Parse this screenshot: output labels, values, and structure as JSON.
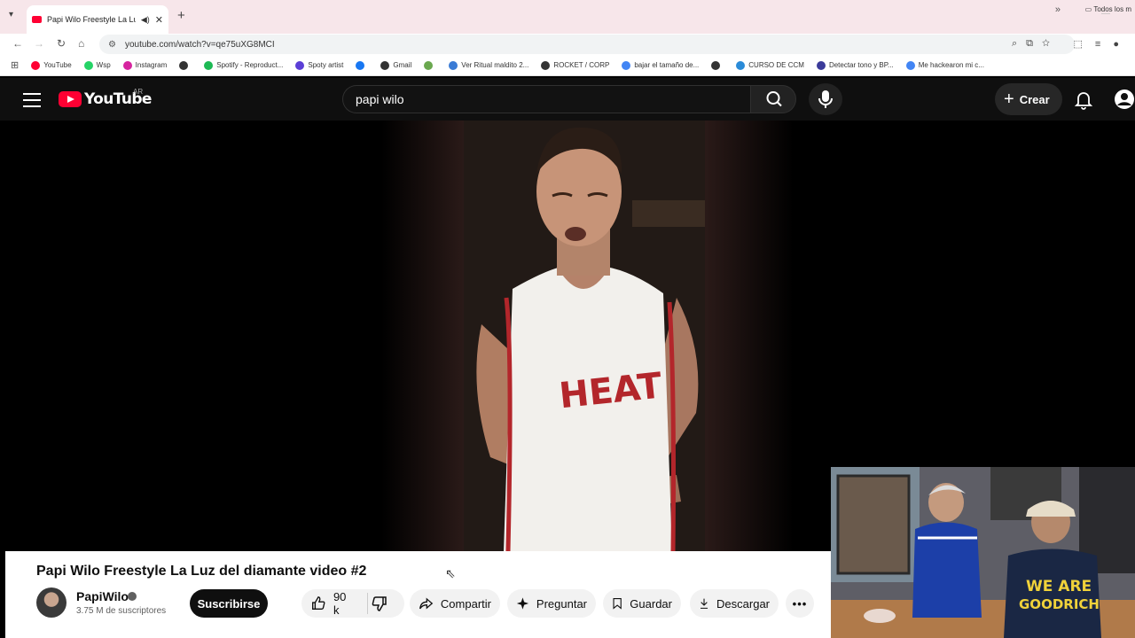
{
  "browser": {
    "tab_title": "Papi Wilo Freestyle La Luz d",
    "url": "youtube.com/watch?v=qe75uXG8MCI",
    "bookmarks": [
      {
        "label": "YouTube",
        "color": "#ff0033"
      },
      {
        "label": "Wsp",
        "color": "#25d366"
      },
      {
        "label": "Instagram",
        "color": "#d6249f"
      },
      {
        "label": "",
        "color": "#333333"
      },
      {
        "label": "Spotify - Reproduct...",
        "color": "#1db954"
      },
      {
        "label": "Spoty artist",
        "color": "#5b3fd6"
      },
      {
        "label": "",
        "color": "#1877f2"
      },
      {
        "label": "Gmail",
        "color": "#333333"
      },
      {
        "label": "",
        "color": "#6aa84f"
      },
      {
        "label": "Ver Ritual maldito 2...",
        "color": "#3a7bd5"
      },
      {
        "label": "ROCKET / CORP",
        "color": "#333333"
      },
      {
        "label": "bajar el tamaño de...",
        "color": "#4285f4"
      },
      {
        "label": "",
        "color": "#333333"
      },
      {
        "label": "CURSO DE CCM",
        "color": "#2a8bd8"
      },
      {
        "label": "Detectar tono y BP...",
        "color": "#3b3b9a"
      },
      {
        "label": "Me hackearon mi c...",
        "color": "#4285f4"
      }
    ],
    "all_bookmarks_label": "Todos los m"
  },
  "youtube": {
    "logo_text": "YouTube",
    "country_code": "AR",
    "search_value": "papi wilo",
    "create_label": "Crear"
  },
  "video": {
    "title": "Papi Wilo Freestyle La Luz del diamante video #2",
    "channel_name": "PapiWilo",
    "subscribers": "3.75 M de suscriptores",
    "subscribe_label": "Suscribirse",
    "likes": "90 k",
    "share_label": "Compartir",
    "ask_label": "Preguntar",
    "save_label": "Guardar",
    "download_label": "Descargar",
    "jersey_text": "HEAT"
  },
  "webcam": {
    "shirt_text_1": "WE ARE",
    "shirt_text_2": "GOODRICH"
  }
}
